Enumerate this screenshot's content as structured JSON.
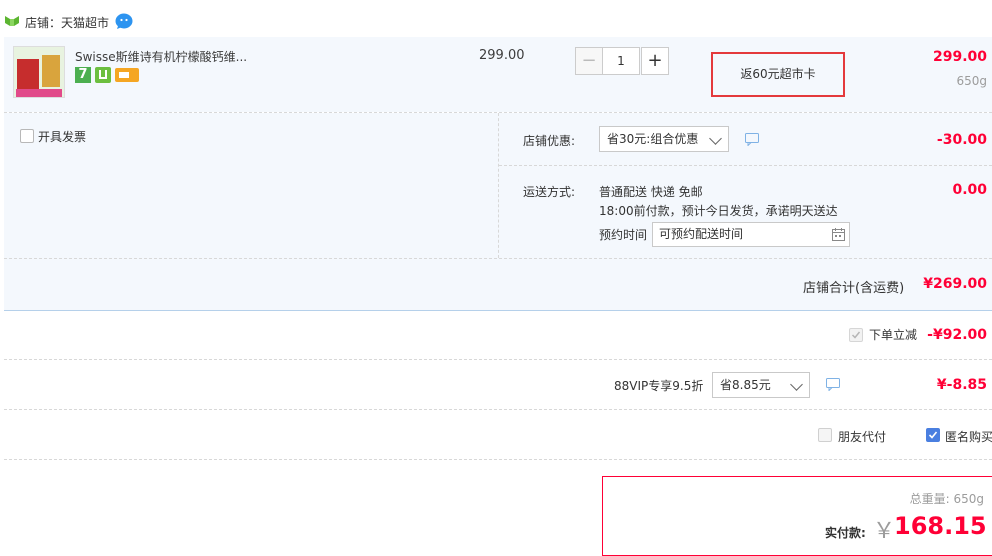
{
  "shop": {
    "label": "店铺：天猫超市"
  },
  "item": {
    "image_alt": "Swisse 柠檬酸钙",
    "title": "Swisse斯维诗有机柠檬酸钙维...",
    "unit_price": "299.00",
    "quantity": "1",
    "decrement": "−",
    "increment": "+",
    "promo": "返60元超市卡",
    "subtotal": "299.00",
    "weight": "650g",
    "badge_7": "7"
  },
  "invoice": {
    "label": "开具发票"
  },
  "shop_discount": {
    "label": "店铺优惠:",
    "selected": "省30元:组合优惠",
    "amount": "-30.00"
  },
  "shipping": {
    "label": "运送方式:",
    "method": "普通配送 快递 免邮",
    "note": "18:00前付款，预计今日发货，承诺明天送达",
    "time_label": "预约时间",
    "time_placeholder": "可预约配送时间",
    "amount": "0.00"
  },
  "shop_total": {
    "label": "店铺合计(含运费)",
    "amount": "¥269.00"
  },
  "instant_discount": {
    "label": "下单立减",
    "amount": "-¥92.00"
  },
  "vip": {
    "label": "88VIP专享9.5折",
    "selected": "省8.85元",
    "amount": "¥-8.85"
  },
  "options": {
    "friend_pay": "朋友代付",
    "anonymous": "匿名购买"
  },
  "summary": {
    "weight_label": "总重量: 650g",
    "paid_label": "实付款:",
    "currency": "￥",
    "paid_amount": "168.15"
  },
  "colors": {
    "accent_red": "#ff0036",
    "blue_bg": "#f4f8fd",
    "border_red": "#e4393c",
    "checkbox_blue": "#4a7fe0"
  }
}
